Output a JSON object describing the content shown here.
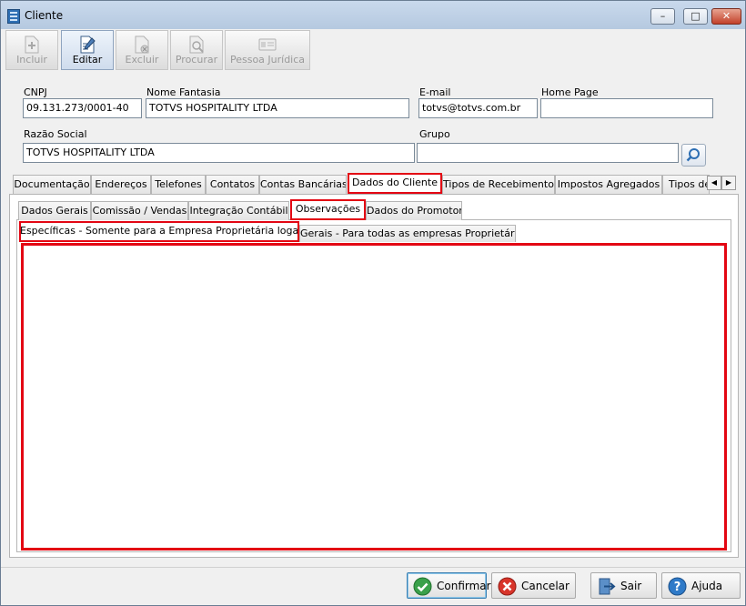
{
  "window": {
    "title": "Cliente"
  },
  "toolbar": {
    "buttons": [
      {
        "label": "Incluir",
        "enabled": false
      },
      {
        "label": "Editar",
        "enabled": true
      },
      {
        "label": "Excluir",
        "enabled": false
      },
      {
        "label": "Procurar",
        "enabled": false
      },
      {
        "label": "Pessoa Jurídica",
        "enabled": false
      }
    ]
  },
  "form": {
    "cnpj": {
      "label": "CNPJ",
      "value": "09.131.273/0001-40"
    },
    "nome_fantasia": {
      "label": "Nome Fantasia",
      "value": "TOTVS HOSPITALITY LTDA"
    },
    "email": {
      "label": "E-mail",
      "value": "totvs@totvs.com.br"
    },
    "home_page": {
      "label": "Home Page",
      "value": ""
    },
    "razao_social": {
      "label": "Razão Social",
      "value": "TOTVS HOSPITALITY LTDA"
    },
    "grupo": {
      "label": "Grupo",
      "value": ""
    }
  },
  "main_tabs": [
    "Documentação",
    "Endereços",
    "Telefones",
    "Contatos",
    "Contas Bancárias",
    "Dados do Cliente",
    "Tipos de Recebimento",
    "Impostos Agregados",
    "Tipos de"
  ],
  "main_tab_selected": "Dados do Cliente",
  "sub_tabs": [
    "Dados Gerais",
    "Comissão / Vendas",
    "Integração Contábil",
    "Observações",
    "Dados do Promotor"
  ],
  "sub_tab_selected": "Observações",
  "obs_tabs": [
    "Específicas - Somente para a Empresa Proprietária logada",
    "Gerais - Para todas as empresas Proprietárias"
  ],
  "obs_tab_selected": "Específicas - Somente para a Empresa Proprietária logada",
  "memo": {
    "value": ""
  },
  "footer": {
    "confirmar": "Confirmar",
    "cancelar": "Cancelar",
    "sair": "Sair",
    "ajuda": "Ajuda"
  },
  "colors": {
    "highlight": "#e30613",
    "accent": "#2e6fb4"
  },
  "icons": [
    "app-icon",
    "add-doc-icon",
    "edit-doc-icon",
    "delete-doc-icon",
    "search-doc-icon",
    "id-card-icon",
    "search-icon",
    "check-icon",
    "cancel-icon",
    "exit-door-icon",
    "help-icon"
  ]
}
